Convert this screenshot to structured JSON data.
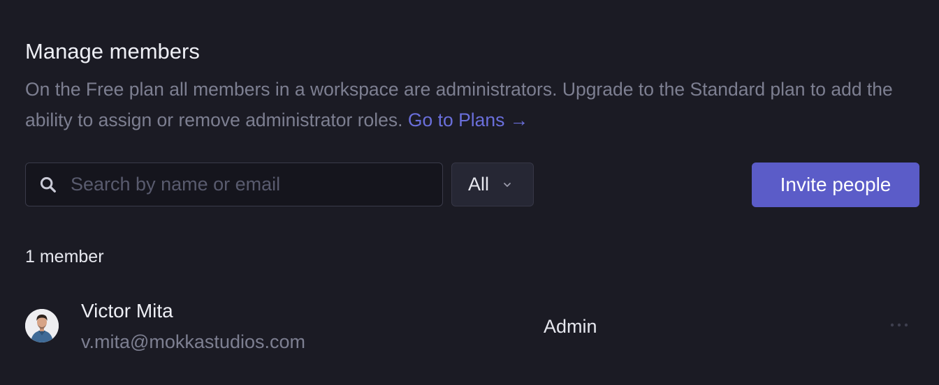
{
  "section": {
    "title": "Manage members",
    "description": "On the Free plan all members in a workspace are administrators. Upgrade to the Standard plan to add the ability to assign or remove administrator roles.",
    "plans_link": "Go to Plans →"
  },
  "toolbar": {
    "search_placeholder": "Search by name or email",
    "search_value": "",
    "filter_value": "All",
    "invite_label": "Invite people"
  },
  "members": {
    "count_label": "1 member",
    "items": [
      {
        "name": "Victor Mita",
        "email": "v.mita@mokkastudios.com",
        "role": "Admin"
      }
    ]
  },
  "icons": {
    "search": "search-icon",
    "filter_chevron": "chevron-down-icon",
    "row_menu": "more-horizontal-icon"
  },
  "colors": {
    "background": "#1b1b24",
    "accent": "#5b5cc8",
    "link": "#6a6fdb",
    "muted_text": "#7d7f91"
  }
}
